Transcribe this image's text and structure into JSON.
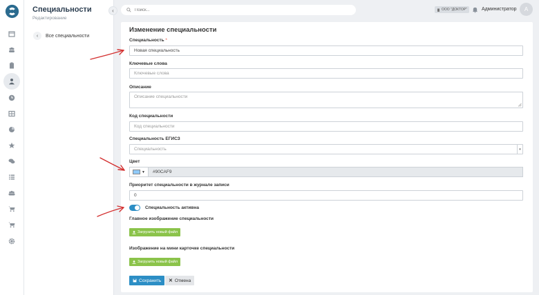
{
  "sidebar": {
    "title": "Специальности",
    "subtitle": "Редактирование",
    "back_label": "Все специальности",
    "rail_icons": [
      "calendar-icon",
      "users-icon",
      "clipboard-icon",
      "user-icon",
      "clock-icon",
      "table-icon",
      "pie-chart-icon",
      "star-icon",
      "chat-icon",
      "list-icon",
      "group-icon",
      "cart-icon",
      "cart-plus-icon",
      "gear-icon"
    ]
  },
  "header": {
    "search_placeholder": "Поиск...",
    "org_badge": "ООО \"ДОКТОР\"",
    "user_name": "Администратор",
    "avatar_letter": "А"
  },
  "form": {
    "title": "Изменение специальности",
    "specialty_label": "Специальность",
    "required_mark": "*",
    "specialty_value": "Новая специальность",
    "keywords_label": "Ключевые слова",
    "keywords_placeholder": "Ключевые слова",
    "description_label": "Описание",
    "description_placeholder": "Описание специальности",
    "code_label": "Код специальности",
    "code_placeholder": "Код специальности",
    "egisz_label": "Специальность ЕГИСЗ",
    "egisz_placeholder": "Специальность",
    "color_label": "Цвет",
    "color_value": "#90CAF9",
    "priority_label": "Приоритет специальности в журнале записи",
    "priority_value": "0",
    "active_label": "Специальность активна",
    "active": true,
    "main_image_label": "Главное изображение специальности",
    "upload_label": "Загрузить новый файл",
    "mini_image_label": "Изображение на мини карточке специальности",
    "upload_label_2": "Загрузить новый файл",
    "save_label": "Сохранить",
    "cancel_label": "Отмена"
  },
  "colors": {
    "accent": "#2c8ec5",
    "upload": "#8bc34a",
    "swatch": "#90caf9",
    "annotation_arrow": "#d32f2f"
  }
}
